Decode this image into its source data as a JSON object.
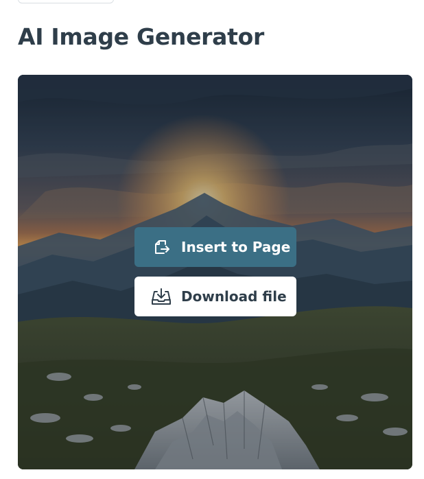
{
  "page": {
    "title": "AI Image Generator"
  },
  "image": {
    "subject": "mountain-sunset-landscape",
    "overlay_color": "#0a1016"
  },
  "actions": {
    "insert_label": "Insert to Page",
    "download_label": "Download file"
  },
  "icons": {
    "insert": "insert-page-icon",
    "download": "download-tray-icon"
  },
  "colors": {
    "title_text": "#2f3e4a",
    "insert_button_bg": "#3b6f85",
    "download_button_bg": "#ffffff"
  }
}
